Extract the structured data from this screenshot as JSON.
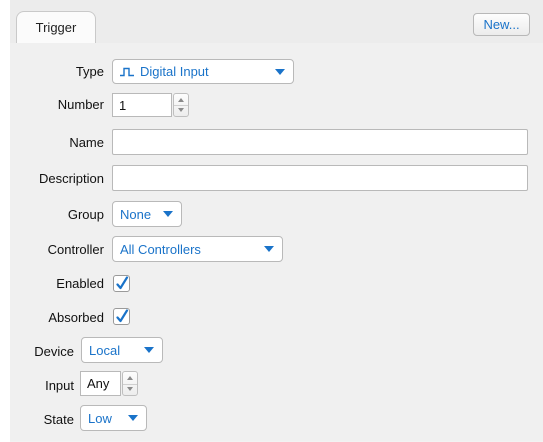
{
  "tab": {
    "label": "Trigger"
  },
  "toolbar": {
    "new_label": "New..."
  },
  "form": {
    "type": {
      "label": "Type",
      "value": "Digital Input",
      "icon": "pulse-icon"
    },
    "number": {
      "label": "Number",
      "value": "1"
    },
    "name": {
      "label": "Name",
      "value": ""
    },
    "description": {
      "label": "Description",
      "value": ""
    },
    "group": {
      "label": "Group",
      "value": "None"
    },
    "controller": {
      "label": "Controller",
      "value": "All Controllers"
    },
    "enabled": {
      "label": "Enabled",
      "checked": true
    },
    "absorbed": {
      "label": "Absorbed",
      "checked": true
    },
    "device": {
      "label": "Device",
      "value": "Local"
    },
    "input": {
      "label": "Input",
      "value": "Any"
    },
    "state": {
      "label": "State",
      "value": "Low"
    }
  },
  "colors": {
    "accent": "#1a73c9",
    "panel": "#f0f0f0"
  }
}
